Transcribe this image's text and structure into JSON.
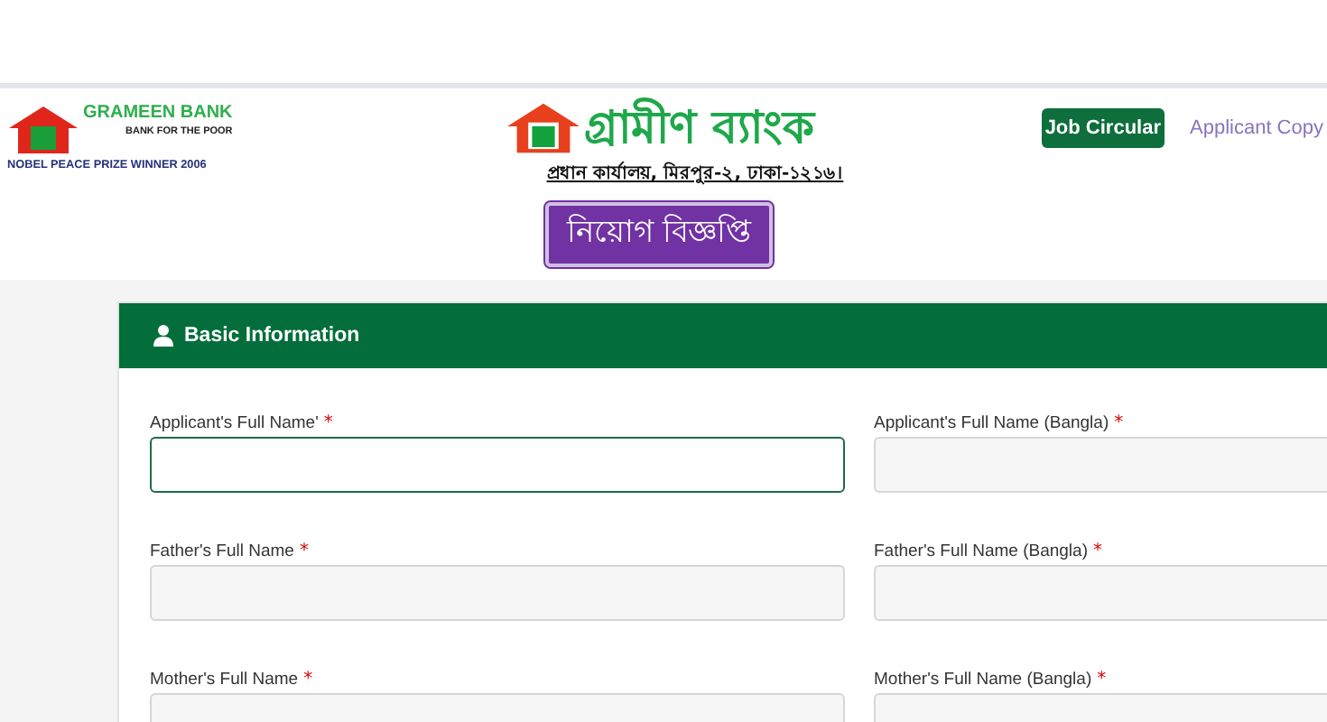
{
  "brand": {
    "name": "GRAMEEN BANK",
    "tagline": "BANK FOR THE POOR",
    "award": "NOBEL PEACE PRIZE WINNER 2006"
  },
  "masthead": {
    "name": "গ্রামীণ ব্যাংক",
    "address": "প্রধান কার্যালয়, মিরপুর-২, ঢাকা-১২১৬।",
    "notice": "নিয়োগ বিজ্ঞপ্তি"
  },
  "nav": [
    {
      "label": "Job Circular",
      "selected": true
    },
    {
      "label": "Applicant Copy",
      "selected": false
    }
  ],
  "section": {
    "title": "Basic Information"
  },
  "fields": [
    {
      "label": "Applicant's Full Name'",
      "required_mark": "*",
      "focused": true
    },
    {
      "label": "Applicant's Full Name (Bangla)",
      "required_mark": "*",
      "focused": false
    },
    {
      "label": "Father's Full Name",
      "required_mark": "*",
      "focused": false
    },
    {
      "label": "Father's Full Name (Bangla)",
      "required_mark": "*",
      "focused": false
    },
    {
      "label": "Mother's Full Name",
      "required_mark": "*",
      "focused": false
    },
    {
      "label": "Mother's Full Name (Bangla)",
      "required_mark": "*",
      "focused": false
    }
  ]
}
